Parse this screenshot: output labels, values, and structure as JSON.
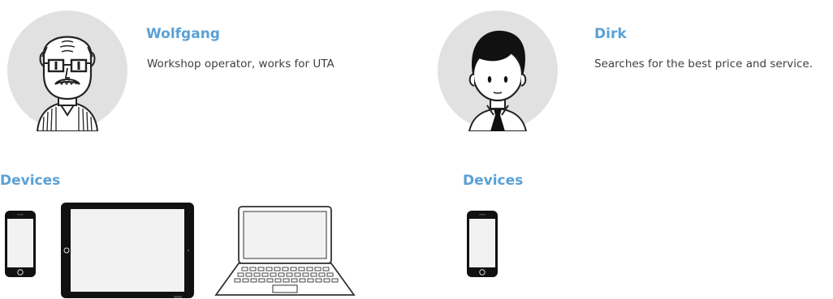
{
  "personas": [
    {
      "name": "Wolfgang",
      "description": "Workshop operator, works for UTA",
      "avatar_icon": "avatar-older-man-glasses-mustache-icon",
      "devices_heading": "Devices",
      "devices": [
        "smartphone-icon",
        "tablet-icon",
        "laptop-icon"
      ]
    },
    {
      "name": "Dirk",
      "description": "Searches for the best price and service.",
      "avatar_icon": "avatar-young-man-tie-icon",
      "devices_heading": "Devices",
      "devices": [
        "smartphone-icon"
      ]
    }
  ],
  "colors": {
    "heading": "#5aa1d6",
    "avatar_bg": "#e1e1e1",
    "text": "#3f3f3f",
    "device_frame": "#1a1a1a"
  }
}
